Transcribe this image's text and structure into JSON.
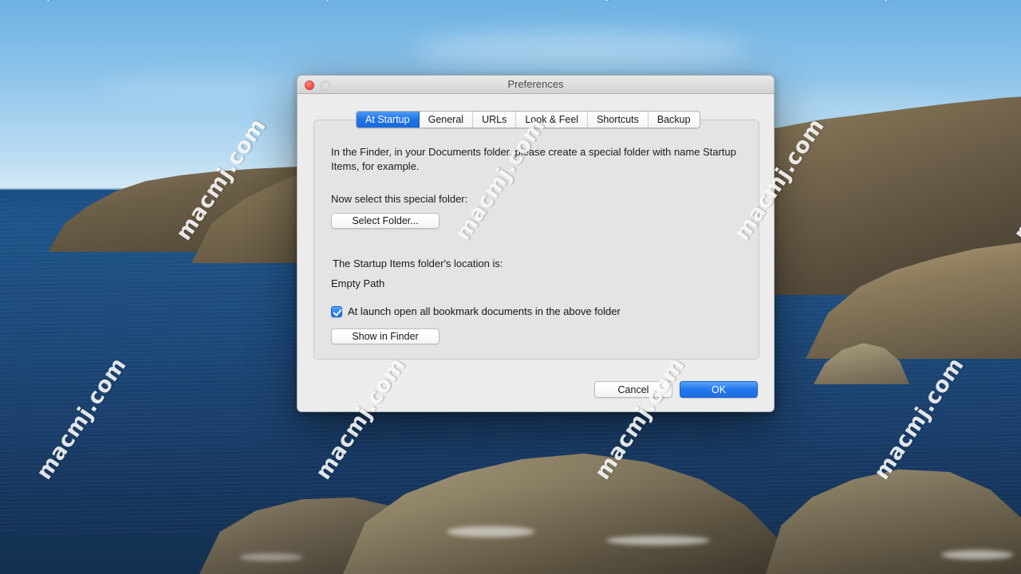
{
  "desktop": {
    "watermark_text": "macmj.com"
  },
  "window": {
    "title": "Preferences",
    "close_button": "close",
    "minimize_button": "minimize"
  },
  "tabs": [
    {
      "label": "At Startup",
      "active": true
    },
    {
      "label": "General",
      "active": false
    },
    {
      "label": "URLs",
      "active": false
    },
    {
      "label": "Look & Feel",
      "active": false
    },
    {
      "label": "Shortcuts",
      "active": false
    },
    {
      "label": "Backup",
      "active": false
    }
  ],
  "at_startup": {
    "intro_text": "In the Finder, in your Documents folder, please create a special folder with name Startup Items, for example.",
    "select_label": "Now select this special folder:",
    "select_folder_button": "Select Folder...",
    "location_label": " The Startup Items folder's location is:",
    "path_value": "Empty Path",
    "checkbox_label": "At launch open all bookmark documents in the above folder",
    "checkbox_checked": true,
    "show_in_finder_button": "Show in Finder"
  },
  "footer": {
    "cancel_label": "Cancel",
    "ok_label": "OK"
  },
  "colors": {
    "accent_blue": "#2479ef",
    "active_tab_blue": "#1f74e8",
    "close_red": "#f9504a",
    "window_bg": "#ececec",
    "panel_bg": "#e4e4e4"
  }
}
